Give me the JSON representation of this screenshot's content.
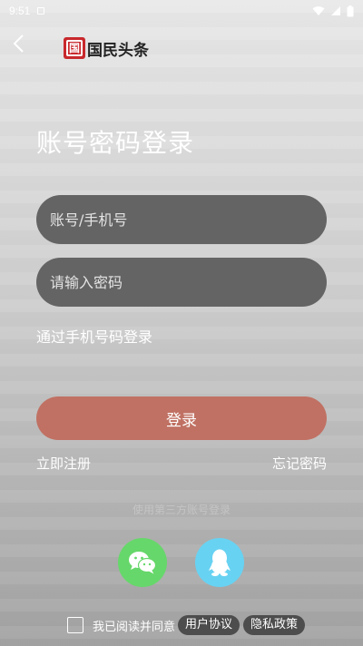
{
  "status_bar": {
    "time": "9:51",
    "icons": [
      "notification-icon",
      "wifi-icon",
      "signal-icon",
      "battery-icon"
    ]
  },
  "header": {
    "back_icon": "chevron-left-icon",
    "logo_mark_char": "国",
    "logo_text": "国民头条",
    "brand_color": "#c8282c"
  },
  "page": {
    "title": "账号密码登录"
  },
  "form": {
    "account_placeholder": "账号/手机号",
    "account_value": "",
    "password_placeholder": "请输入密码",
    "password_value": "",
    "phone_login_link": "通过手机号码登录",
    "login_button": "登录",
    "login_button_color": "#c07163",
    "register_link": "立即注册",
    "forgot_password_link": "忘记密码"
  },
  "third_party": {
    "label": "使用第三方账号登录",
    "providers": [
      {
        "name": "wechat",
        "icon": "wechat-icon",
        "color": "#66d76a"
      },
      {
        "name": "qq",
        "icon": "qq-icon",
        "color": "#68d2f2"
      }
    ]
  },
  "agreement": {
    "checked": false,
    "text": "我已阅读并同意",
    "user_agreement": "用户协议",
    "privacy_policy": "隐私政策"
  }
}
